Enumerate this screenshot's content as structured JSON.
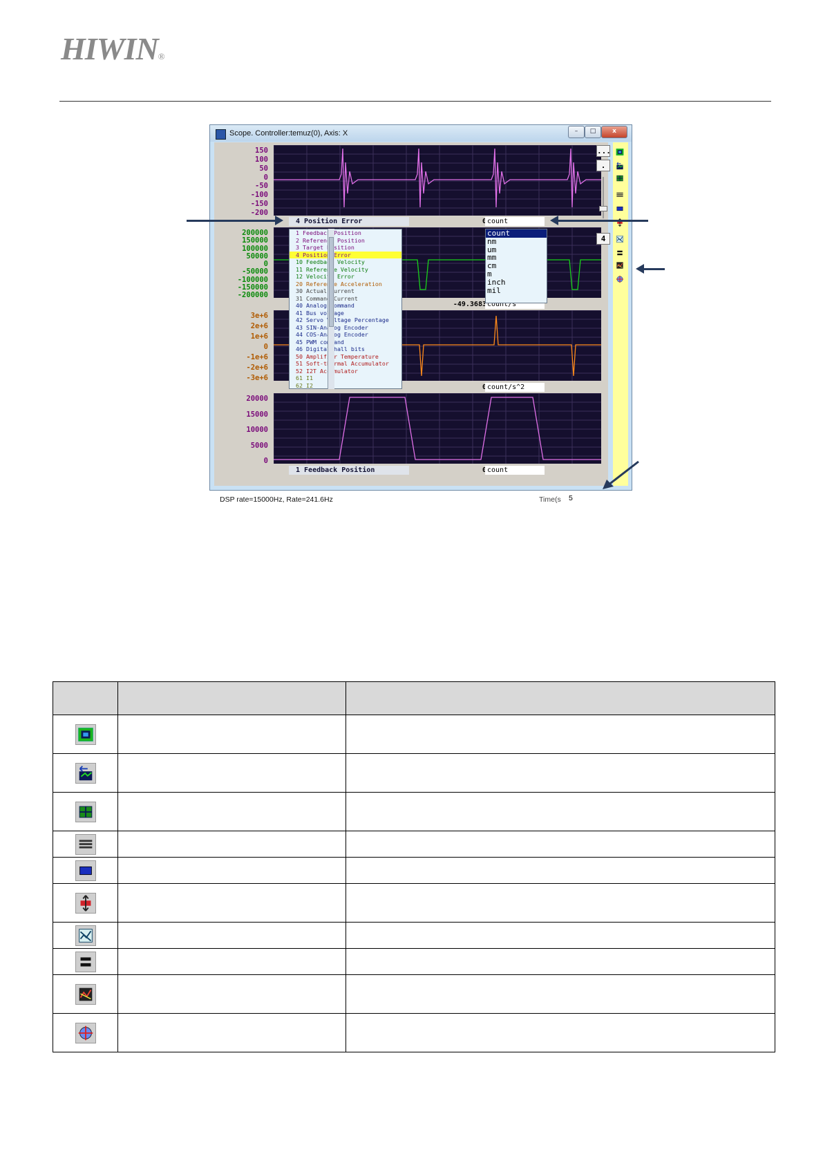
{
  "brand": {
    "name": "HIWIN",
    "registered": "®"
  },
  "window": {
    "title": "Scope. Controller:temuz(0), Axis: X",
    "controls": {
      "minimize": "–",
      "maximize": "□",
      "close": "x"
    },
    "status": "DSP rate=15000Hz, Rate=241.6Hz",
    "time_label": "Time(s",
    "time_value": "5",
    "side_buttons": {
      "more": "...",
      "dot": ".",
      "count": "4"
    }
  },
  "channels": [
    {
      "axis_ticks": [
        "150",
        "100",
        "50",
        "0",
        "-50",
        "-100",
        "-150",
        "-200"
      ],
      "axis_color": "#7a0a7a",
      "trace_color": "#e070e8",
      "variable": "4  Position Error",
      "value": "0",
      "unit": "count"
    },
    {
      "axis_ticks": [
        "200000",
        "150000",
        "100000",
        "50000",
        "0",
        "-50000",
        "-100000",
        "-150000",
        "-200000"
      ],
      "axis_color": "#0a8a0a",
      "trace_color": "#19d11a",
      "value": "-49.3683",
      "unit": "count/s"
    },
    {
      "axis_ticks": [
        "3e+6",
        "2e+6",
        "1e+6",
        "0",
        "-1e+6",
        "-2e+6",
        "-3e+6"
      ],
      "axis_color": "#b05a00",
      "trace_color": "#ff8a1a",
      "value": "0",
      "unit": "count/s^2"
    },
    {
      "axis_ticks": [
        "20000",
        "15000",
        "10000",
        "5000",
        "0"
      ],
      "axis_color": "#7a0a7a",
      "trace_color": "#e070e8",
      "variable": "1  Feedback Position",
      "value": "0",
      "unit": "count"
    }
  ],
  "variable_list": [
    {
      "label": "1  Feedback Position",
      "color": "#7a0a7a"
    },
    {
      "label": "2  Reference Position",
      "color": "#7a0a7a"
    },
    {
      "label": "3  Target Position",
      "color": "#7a0a7a"
    },
    {
      "label": "4  Position Error",
      "color": "#7a0a7a",
      "selected": true
    },
    {
      "label": "10 Feedback Velocity",
      "color": "#0a7a0a"
    },
    {
      "label": "11 Reference Velocity",
      "color": "#0a7a0a"
    },
    {
      "label": "12 Velocity Error",
      "color": "#0a7a0a"
    },
    {
      "label": "20 Reference Acceleration",
      "color": "#b05a00"
    },
    {
      "label": "30 Actual Current",
      "color": "#444444"
    },
    {
      "label": "31 Command Current",
      "color": "#444444"
    },
    {
      "label": "40 Analog Command",
      "color": "#1a2a8a"
    },
    {
      "label": "41 Bus voltage",
      "color": "#1a2a8a"
    },
    {
      "label": "42 Servo Voltage Percentage",
      "color": "#1a2a8a"
    },
    {
      "label": "43 SIN-Analog Encoder",
      "color": "#1a2a8a"
    },
    {
      "label": "44 COS-Analog Encoder",
      "color": "#1a2a8a"
    },
    {
      "label": "45 PWM command",
      "color": "#1a2a8a"
    },
    {
      "label": "46 Digital hall bits",
      "color": "#1a2a8a"
    },
    {
      "label": "50 Amplifier Temperature",
      "color": "#b01a1a"
    },
    {
      "label": "51 Soft-thermal Accumulator",
      "color": "#b01a1a"
    },
    {
      "label": "52 I2T Accumulator",
      "color": "#b01a1a"
    },
    {
      "label": "61 I1",
      "color": "#6a7a1a"
    },
    {
      "label": "62 I2",
      "color": "#6a7a1a"
    }
  ],
  "unit_list": [
    "count",
    "nm",
    "um",
    "mm",
    "cm",
    "m",
    "inch",
    "mil"
  ],
  "toolbar_icons": [
    "fit-window-icon",
    "autoscale-icon",
    "quad-layout-icon",
    "stack-view-icon",
    "single-view-icon",
    "zoom-vertical-icon",
    "math-channel-icon",
    "split-channel-icon",
    "signal-analysis-icon",
    "crosshair-icon"
  ],
  "legend_table": {
    "headers": [
      "",
      "",
      ""
    ],
    "rows": [
      {
        "icon": "fit-window-icon",
        "name": "",
        "description": ""
      },
      {
        "icon": "autoscale-icon",
        "name": "",
        "description": ""
      },
      {
        "icon": "quad-layout-icon",
        "name": "",
        "description": ""
      },
      {
        "icon": "stack-view-icon",
        "name": "",
        "description": ""
      },
      {
        "icon": "single-view-icon",
        "name": "",
        "description": ""
      },
      {
        "icon": "zoom-vertical-icon",
        "name": "",
        "description": ""
      },
      {
        "icon": "math-channel-icon",
        "name": "",
        "description": ""
      },
      {
        "icon": "split-channel-icon",
        "name": "",
        "description": ""
      },
      {
        "icon": "signal-analysis-icon",
        "name": "",
        "description": ""
      },
      {
        "icon": "crosshair-icon",
        "name": "",
        "description": ""
      }
    ]
  }
}
